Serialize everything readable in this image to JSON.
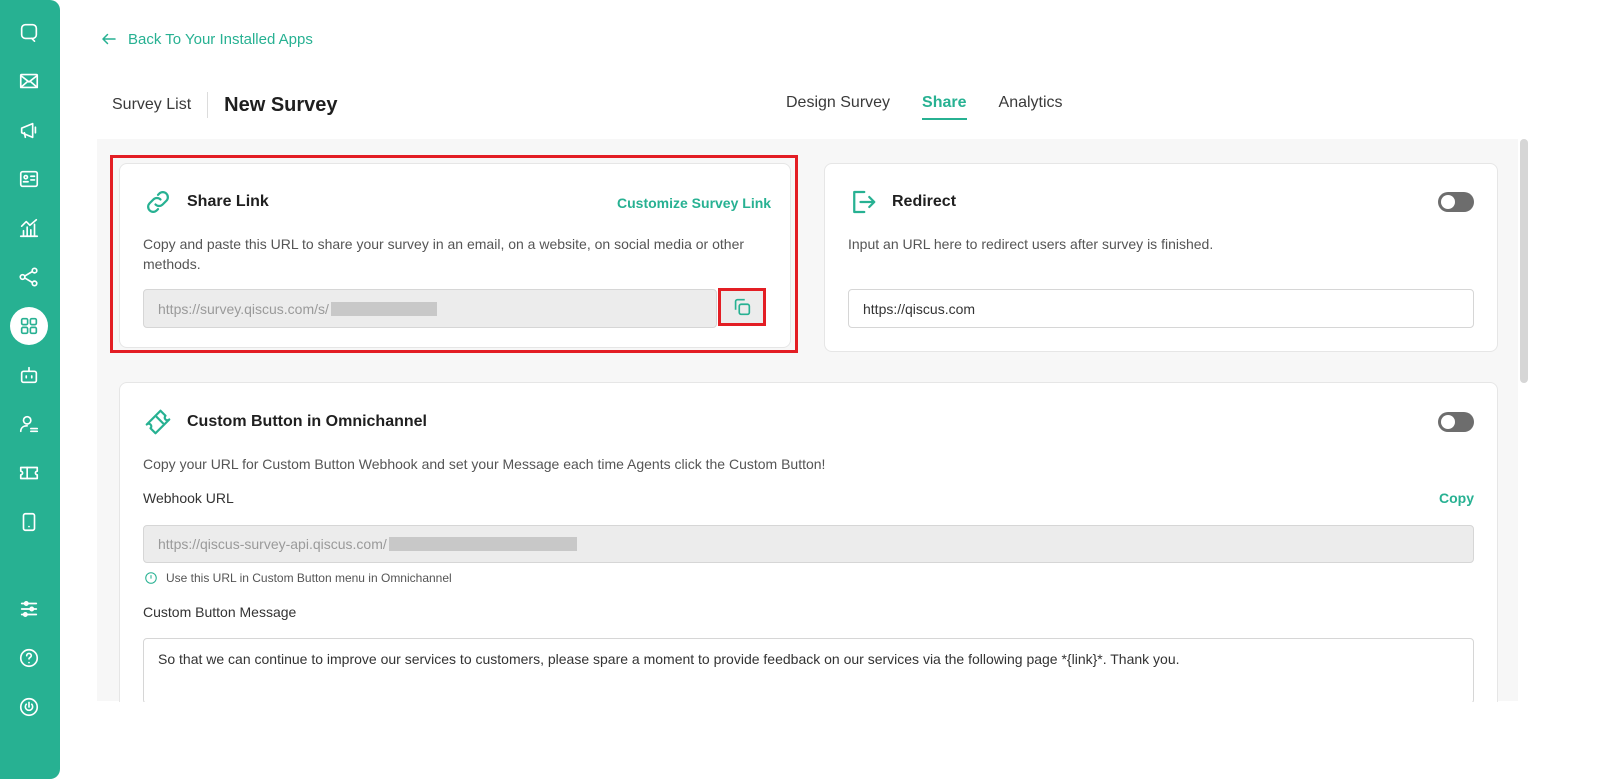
{
  "sidebar": {
    "items": [
      "chat-icon",
      "mail-icon",
      "broadcast-icon",
      "contact-card-icon",
      "analytics-icon",
      "integration-icon",
      "apps-icon",
      "bot-icon",
      "agent-icon",
      "ticket-icon",
      "mobile-icon",
      "settings-icon",
      "help-icon",
      "power-icon"
    ],
    "active": "apps-icon"
  },
  "back_link": "Back To Your Installed Apps",
  "breadcrumb": {
    "list": "Survey List",
    "title": "New Survey"
  },
  "tabs": [
    {
      "label": "Design Survey",
      "active": false
    },
    {
      "label": "Share",
      "active": true
    },
    {
      "label": "Analytics",
      "active": false
    }
  ],
  "share_link": {
    "title": "Share Link",
    "customize": "Customize Survey Link",
    "description": "Copy and paste this URL to share your survey in an email, on a website, on social media or other methods.",
    "url": "https://survey.qiscus.com/s/"
  },
  "redirect": {
    "title": "Redirect",
    "description": "Input an URL here to redirect users after survey is finished.",
    "url": "https://qiscus.com",
    "enabled": false
  },
  "custom_button": {
    "title": "Custom Button in Omnichannel",
    "description": "Copy your URL for Custom Button Webhook and set your Message each time Agents click the Custom Button!",
    "webhook_label": "Webhook URL",
    "copy": "Copy",
    "webhook_url": "https://qiscus-survey-api.qiscus.com/",
    "hint": "Use this URL in Custom Button menu in Omnichannel",
    "message_label": "Custom Button Message",
    "message": "So that we can continue to improve our services to customers, please spare a moment to provide feedback on our services via the following page *{link}*. Thank you.",
    "enabled": false
  },
  "colors": {
    "accent": "#27b192",
    "highlight": "#e31e24"
  }
}
